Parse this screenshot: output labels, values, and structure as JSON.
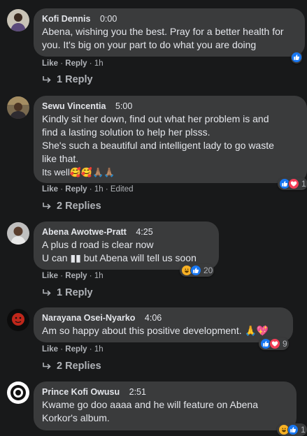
{
  "comments": [
    {
      "name": "Kofi Dennis",
      "time": "0:00",
      "lines": [
        "Abena, wishing you the best. Pray for a better health for",
        "you. It's big on your part to do what you are doing"
      ],
      "actions": {
        "like": "Like",
        "sep1": "·",
        "reply": "Reply",
        "sep2": "·",
        "time": "1h"
      },
      "replies": "1 Reply",
      "reaction_count": ""
    },
    {
      "name": "Sewu Vincentia",
      "time": "5:00",
      "lines": [
        "Kindly sit her down, find out what her problem is and",
        "find a lasting solution to help her plsss.",
        "She's such a beautiful and intelligent lady to go waste",
        "like that.",
        "Its well🥰🥰🙏🏽🙏🏽"
      ],
      "actions": {
        "like": "Like",
        "sep1": "·",
        "reply": "Reply",
        "sep2": "·",
        "time": "1h",
        "sep3": "·",
        "edited": "Edited"
      },
      "replies": "2 Replies",
      "reaction_count": "1"
    },
    {
      "name": "Abena Awotwe-Pratt",
      "time": "4:25",
      "lines": [
        "A plus d road is clear now",
        "U can ▮▮ but Abena will tell us soon"
      ],
      "actions": {
        "like": "Like",
        "sep1": "·",
        "reply": "Reply",
        "sep2": "·",
        "time": "1h"
      },
      "replies": "1 Reply",
      "reaction_count": "20"
    },
    {
      "name": "Narayana Osei-Nyarko",
      "time": "4:06",
      "lines": [
        "Am so happy about this positive development. 🙏💖"
      ],
      "actions": {
        "like": "Like",
        "sep1": "·",
        "reply": "Reply",
        "sep2": "·",
        "time": "1h"
      },
      "replies": "2 Replies",
      "reaction_count": "9"
    },
    {
      "name": "Prince Kofi Owusu",
      "time": "2:51",
      "lines": [
        "Kwame go doo aaaa and he will feature on Abena",
        "Korkor's album."
      ],
      "reaction_count": "1"
    }
  ],
  "colors": {
    "background": "#18191a",
    "bubble": "#3a3b3c",
    "like": "#1877f2",
    "love": "#f33e58",
    "haha": "#f7b125"
  },
  "icons": [
    "avatar",
    "reply-arrow-icon",
    "like-reaction-icon",
    "love-reaction-icon",
    "haha-reaction-icon"
  ]
}
